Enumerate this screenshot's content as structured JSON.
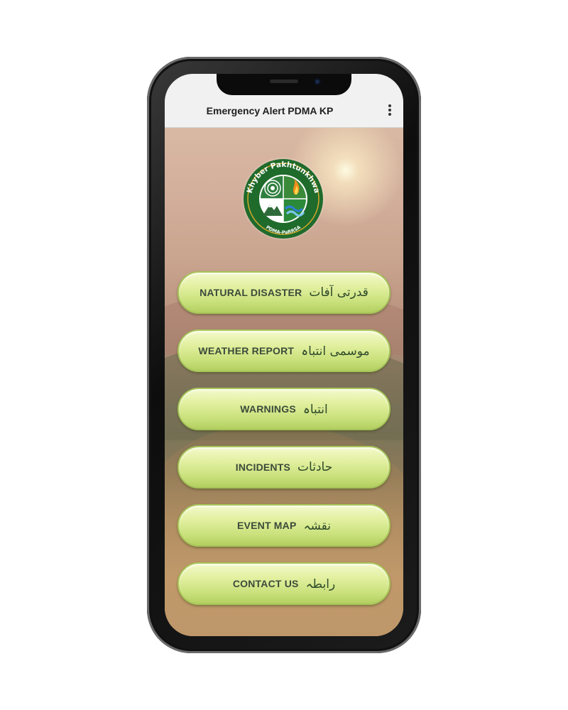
{
  "app_bar": {
    "title": "Emergency Alert PDMA KP",
    "menu_icon": "more-vertical-icon"
  },
  "logo": {
    "top_text": "Khyber Pakhtunkhwa",
    "bottom_text": "PDMA-PaRRSA",
    "colors": {
      "ring": "#1f6b2c",
      "accent": "#d4a72c"
    }
  },
  "menu": {
    "buttons": [
      {
        "english": "NATURAL DISASTER",
        "urdu": "قدرتی آفات"
      },
      {
        "english": "WEATHER REPORT",
        "urdu": "موسمی انتباہ"
      },
      {
        "english": "WARNINGS",
        "urdu": "انتباہ"
      },
      {
        "english": "INCIDENTS",
        "urdu": "حادثات"
      },
      {
        "english": "EVENT MAP",
        "urdu": "نقشہ"
      },
      {
        "english": "CONTACT US",
        "urdu": "رابطہ"
      }
    ]
  },
  "colors": {
    "button_fill": "#d9ea8f",
    "button_border": "#a7c559",
    "button_text": "#3c4a3a",
    "app_bar": "#f1f1f1"
  }
}
